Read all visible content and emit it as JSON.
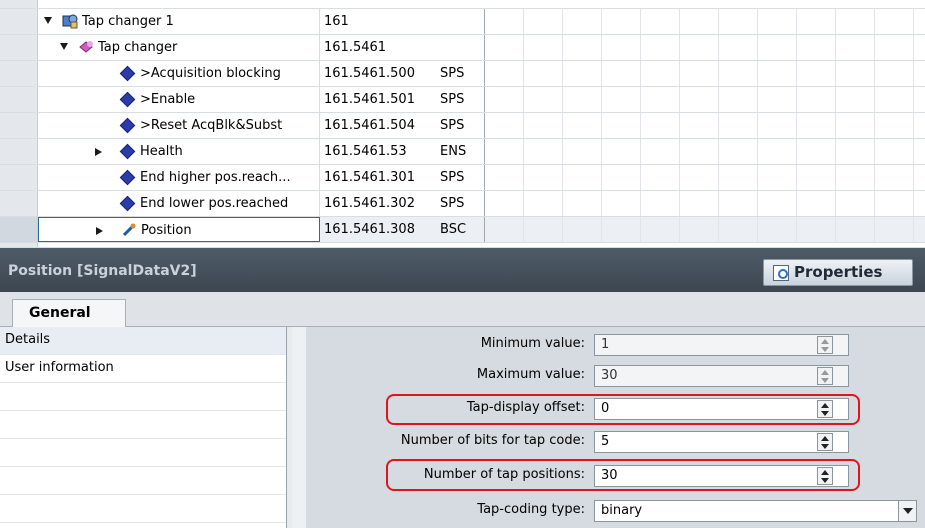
{
  "tree": {
    "rows": [
      {
        "name": "Tap changer 1",
        "address": "161",
        "type": "",
        "indent": 1,
        "expander": "down",
        "icon": "device-gear-icon"
      },
      {
        "name": "Tap changer",
        "address": "161.5461",
        "type": "",
        "indent": 2,
        "expander": "down",
        "icon": "function-block-icon"
      },
      {
        "name": ">Acquisition blocking",
        "address": "161.5461.500",
        "type": "SPS",
        "indent": 3,
        "expander": "",
        "icon": "signal-diamond-icon"
      },
      {
        "name": ">Enable",
        "address": "161.5461.501",
        "type": "SPS",
        "indent": 3,
        "expander": "",
        "icon": "signal-diamond-icon"
      },
      {
        "name": ">Reset AcqBlk&Subst",
        "address": "161.5461.504",
        "type": "SPS",
        "indent": 3,
        "expander": "",
        "icon": "signal-diamond-icon"
      },
      {
        "name": "Health",
        "address": "161.5461.53",
        "type": "ENS",
        "indent": 3,
        "expander": "right",
        "icon": "signal-diamond-icon"
      },
      {
        "name": "End higher pos.reach...",
        "address": "161.5461.301",
        "type": "SPS",
        "indent": 3,
        "expander": "",
        "icon": "signal-diamond-icon"
      },
      {
        "name": "End lower pos.reached",
        "address": "161.5461.302",
        "type": "SPS",
        "indent": 3,
        "expander": "",
        "icon": "signal-diamond-icon"
      },
      {
        "name": "Position",
        "address": "161.5461.308",
        "type": "BSC",
        "indent": 3,
        "expander": "right",
        "icon": "position-tool-icon",
        "selected": true
      }
    ]
  },
  "properties": {
    "title": "Position [SignalDataV2]",
    "button_label": "Properties",
    "tab_general": "General",
    "nav": [
      {
        "label": "Details",
        "selected": true
      },
      {
        "label": "User information",
        "selected": false
      }
    ],
    "fields": {
      "min_label": "Minimum value:",
      "min_value": "1",
      "max_label": "Maximum value:",
      "max_value": "30",
      "offset_label": "Tap-display offset:",
      "offset_value": "0",
      "bits_label": "Number of bits for tap code:",
      "bits_value": "5",
      "positions_label": "Number of tap positions:",
      "positions_value": "30",
      "coding_label": "Tap-coding type:",
      "coding_value": "binary"
    }
  },
  "colors": {
    "highlight": "#e0141d",
    "header_bg": "#3c4650",
    "signal_icon": "#2b3ba8"
  }
}
